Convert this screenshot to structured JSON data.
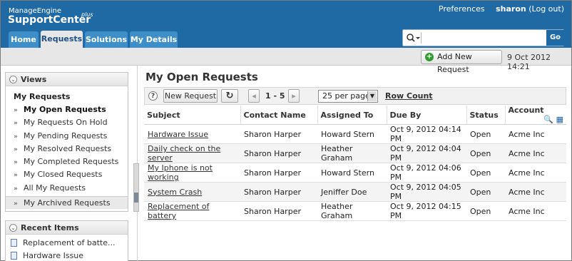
{
  "brand": {
    "small": "ManageEngine",
    "big": "SupportCenter",
    "sup": "plus"
  },
  "top_links": {
    "preferences": "Preferences",
    "user": "sharon",
    "logout": "(Log out)"
  },
  "tabs": [
    {
      "label": "Home"
    },
    {
      "label": "Requests"
    },
    {
      "label": "Solutions"
    },
    {
      "label": "My Details"
    }
  ],
  "search": {
    "placeholder": "",
    "go_label": "Go",
    "scope_icon": "search-icon"
  },
  "toolbar": {
    "add_new_request": "Add New Request",
    "date": "9 Oct 2012 14:21"
  },
  "views": {
    "header": "Views",
    "title": "My Requests",
    "items": [
      {
        "label": "My Open Requests"
      },
      {
        "label": "My Requests On Hold"
      },
      {
        "label": "My Pending Requests"
      },
      {
        "label": "My Resolved Requests"
      },
      {
        "label": "My Completed Requests"
      },
      {
        "label": "My Closed Requests"
      },
      {
        "label": "All My Requests"
      },
      {
        "label": "My Archived Requests"
      }
    ]
  },
  "recent": {
    "header": "Recent Items",
    "items": [
      {
        "label": "Replacement of batte..."
      },
      {
        "label": "Hardware Issue"
      }
    ]
  },
  "main": {
    "title": "My Open Requests",
    "new_request": "New Request",
    "range": "1 - 5",
    "per_page": "25 per page",
    "row_count": "Row Count",
    "columns": [
      "Subject",
      "Contact Name",
      "Assigned To",
      "Due By",
      "Status",
      "Account"
    ],
    "rows": [
      {
        "subject": "Hardware Issue",
        "contact": "Sharon Harper",
        "assigned": "Howard Stern",
        "due": "Oct 9, 2012 04:14 PM",
        "status": "Open",
        "account": "Acme Inc"
      },
      {
        "subject": "Daily check on the server",
        "contact": "Sharon Harper",
        "assigned": "Heather Graham",
        "due": "Oct 9, 2012 04:04 PM",
        "status": "Open",
        "account": "Acme Inc"
      },
      {
        "subject": "My Iphone is not working",
        "contact": "Sharon Harper",
        "assigned": "Howard Stern",
        "due": "Oct 9, 2012 04:06 PM",
        "status": "Open",
        "account": "Acme Inc"
      },
      {
        "subject": "System Crash",
        "contact": "Sharon Harper",
        "assigned": "Jeniffer Doe",
        "due": "Oct 9, 2012 04:05 PM",
        "status": "Open",
        "account": "Acme Inc"
      },
      {
        "subject": "Replacement of battery",
        "contact": "Sharon Harper",
        "assigned": "Heather Graham",
        "due": "Oct 9, 2012 04:15 PM",
        "status": "Open",
        "account": "Acme Inc"
      }
    ]
  },
  "colors": {
    "header": "#1f6aa5",
    "tab": "#3d8ec9",
    "add_icon": "#2f9a2f"
  }
}
